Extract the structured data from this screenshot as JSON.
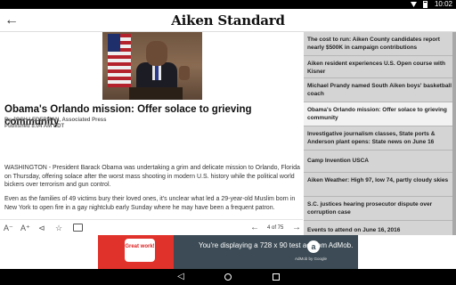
{
  "status": {
    "time": "10:02",
    "wifi_icon": "wifi-icon",
    "battery_icon": "battery-icon"
  },
  "app": {
    "masthead": "Aiken Standard",
    "back_icon": "arrow-back-icon"
  },
  "article": {
    "headline": "Obama's Orlando mission: Offer solace to grieving community",
    "byline": "By JOSH LEDERMAN, Associated Press",
    "published": "Published 8:04 AM CDT",
    "paragraphs": [
      "WASHINGTON - President Barack Obama was undertaking a grim and delicate mission to Orlando, Florida on Thursday, offering solace after the worst mass shooting in modern U.S. history while the political world bickers over terrorism and gun control.",
      "Even as the families of 49 victims bury their loved ones, it's unclear what led a 29-year-old Muslim born in New York to open fire in a gay nightclub early Sunday where he may have been a frequent patron."
    ]
  },
  "toolbar": {
    "font_decrease": "A⁻",
    "font_increase": "A⁺",
    "counter": "4 of 75",
    "prev_icon": "arrow-left-icon",
    "next_icon": "arrow-right-icon",
    "share_icon": "share-icon",
    "star_icon": "star-icon",
    "comment_icon": "comment-icon"
  },
  "sidebar": {
    "items": [
      {
        "title": "The cost to run: Aiken County candidates report nearly $500K in campaign contributions",
        "active": false
      },
      {
        "title": "Aiken resident experiences U.S. Open course with Kisner",
        "active": false
      },
      {
        "title": "Michael Prandy named South Aiken boys' basketball coach",
        "active": false
      },
      {
        "title": "Obama's Orlando mission: Offer solace to grieving community",
        "active": true
      },
      {
        "title": "Investigative journalism classes, State ports & Anderson plant opens: State news on June 16",
        "active": false
      },
      {
        "title": "Camp Invention USCA",
        "active": false
      },
      {
        "title": "Aiken Weather: High 97, low 74, partly cloudy skies",
        "active": false
      },
      {
        "title": "S.C. justices hearing prosecutor dispute over corruption case",
        "active": false
      },
      {
        "title": "Events to attend on June 16, 2016",
        "active": false
      }
    ]
  },
  "ad": {
    "bubble_text": "Great work!",
    "message": "You're displaying a 728 x 90 test ad from AdMob.",
    "brand": "AdMob by Google"
  }
}
